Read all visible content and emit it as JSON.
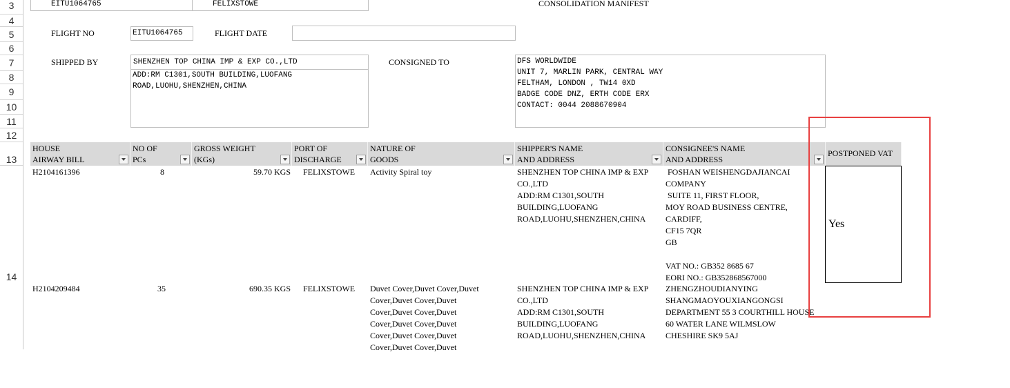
{
  "row_numbers": [
    "3",
    "4",
    "5",
    "6",
    "7",
    "8",
    "9",
    "10",
    "11",
    "12",
    "13",
    "14"
  ],
  "top_row": {
    "container": "EITU1064765",
    "port": "FELIXSTOWE",
    "title": "CONSOLIDATION MANIFEST"
  },
  "flight": {
    "flight_no_label": "FLIGHT NO",
    "flight_no_value": "EITU1064765",
    "flight_date_label": "FLIGHT DATE",
    "flight_date_value": ""
  },
  "shipped_by": {
    "label": "SHIPPED BY",
    "name": "SHENZHEN TOP CHINA IMP & EXP CO.,LTD",
    "address": "ADD:RM C1301,SOUTH BUILDING,LUOFANG\nROAD,LUOHU,SHENZHEN,CHINA"
  },
  "consigned_to": {
    "label": "CONSIGNED TO",
    "text": "DFS WORLDWIDE\nUNIT 7, MARLIN PARK, CENTRAL WAY\nFELTHAM, LONDON , TW14 0XD\nBADGE CODE DNZ, ERTH CODE ERX\nCONTACT: 0044 2088670904"
  },
  "table": {
    "headers": {
      "hawb": "HOUSE\nAIRWAY BILL",
      "pcs": "NO OF\nPCs",
      "weight": "GROSS WEIGHT\n(KGs)",
      "port": "PORT OF\nDISCHARGE",
      "goods": "NATURE OF\nGOODS",
      "shipper": "SHIPPER'S NAME\nAND ADDRESS",
      "consignee": "CONSIGNEE'S NAME\nAND ADDRESS",
      "vat": "POSTPONED VAT"
    },
    "rows": [
      {
        "hawb": "H2104161396",
        "pcs": "8",
        "weight": "59.70 KGS",
        "port": "FELIXSTOWE",
        "goods": "Activity Spiral toy",
        "shipper": "SHENZHEN TOP CHINA IMP & EXP\nCO.,LTD\nADD:RM C1301,SOUTH\nBUILDING,LUOFANG\nROAD,LUOHU,SHENZHEN,CHINA",
        "consignee": " FOSHAN WEISHENGDAJIANCAI\nCOMPANY\n SUITE 11, FIRST FLOOR,\nMOY ROAD BUSINESS CENTRE,\nCARDIFF,\nCF15 7QR\nGB\n\nVAT NO.: GB352 8685 67\nEORI NO.: GB352868567000",
        "vat": "Yes"
      },
      {
        "hawb": "H2104209484",
        "pcs": "35",
        "weight": "690.35 KGS",
        "port": "FELIXSTOWE",
        "goods": "Duvet Cover,Duvet Cover,Duvet\nCover,Duvet Cover,Duvet\nCover,Duvet Cover,Duvet\nCover,Duvet Cover,Duvet\nCover,Duvet Cover,Duvet\nCover,Duvet Cover,Duvet",
        "shipper": "SHENZHEN TOP CHINA IMP & EXP\nCO.,LTD\nADD:RM C1301,SOUTH\nBUILDING,LUOFANG\nROAD,LUOHU,SHENZHEN,CHINA",
        "consignee": "ZHENGZHOUDIANYING\nSHANGMAOYOUXIANGONGSI\nDEPARTMENT 55 3 COURTHILL HOUSE\n60 WATER LANE WILMSLOW\nCHESHIRE SK9 5AJ"
      }
    ]
  },
  "colors": {
    "header_bg": "#d9d9d9",
    "highlight": "#e84040",
    "grid": "#d4d4d4"
  }
}
